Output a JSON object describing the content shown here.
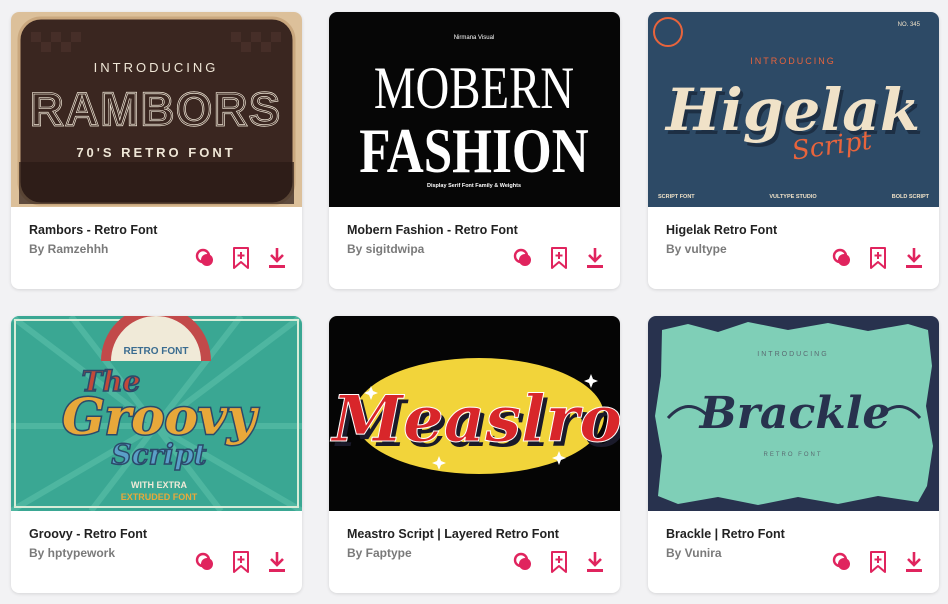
{
  "accent_color": "#e0245e",
  "action_icons": [
    "compare-fonts-icon",
    "add-to-collection-icon",
    "download-icon"
  ],
  "cards": [
    {
      "title": "Rambors - Retro Font",
      "author": "By Ramzehhh",
      "preview": {
        "intro": "INTRODUCING",
        "name": "RAMBORS",
        "tagline": "70'S RETRO FONT"
      }
    },
    {
      "title": "Mobern Fashion - Retro Font",
      "author": "By sigitdwipa",
      "preview": {
        "studio": "Nirmana Visual",
        "line1": "MOBERN",
        "line2": "FASHION",
        "tagline": "Display Serif Font Family & Weights"
      }
    },
    {
      "title": "Higelak Retro Font",
      "author": "By vultype",
      "preview": {
        "intro": "INTRODUCING",
        "name": "Higelak",
        "sub": "Script",
        "number": "NO. 345",
        "left": "SCRIPT FONT",
        "center": "VULTYPE STUDIO",
        "right": "BOLD SCRIPT"
      }
    },
    {
      "title": "Groovy - Retro Font",
      "author": "By hptypework",
      "preview": {
        "badge": "RETRO FONT",
        "line1": "The",
        "line2": "Groovy",
        "line3": "Script",
        "extra1": "WITH EXTRA",
        "extra2": "EXTRUDED FONT"
      }
    },
    {
      "title": "Meastro Script | Layered Retro Font",
      "author": "By Faptype",
      "preview": {
        "name": "Measlro"
      }
    },
    {
      "title": "Brackle | Retro Font",
      "author": "By Vunira",
      "preview": {
        "intro": "INTRODUCING",
        "name": "Brackle",
        "tagline": "RETRO FONT"
      }
    }
  ]
}
